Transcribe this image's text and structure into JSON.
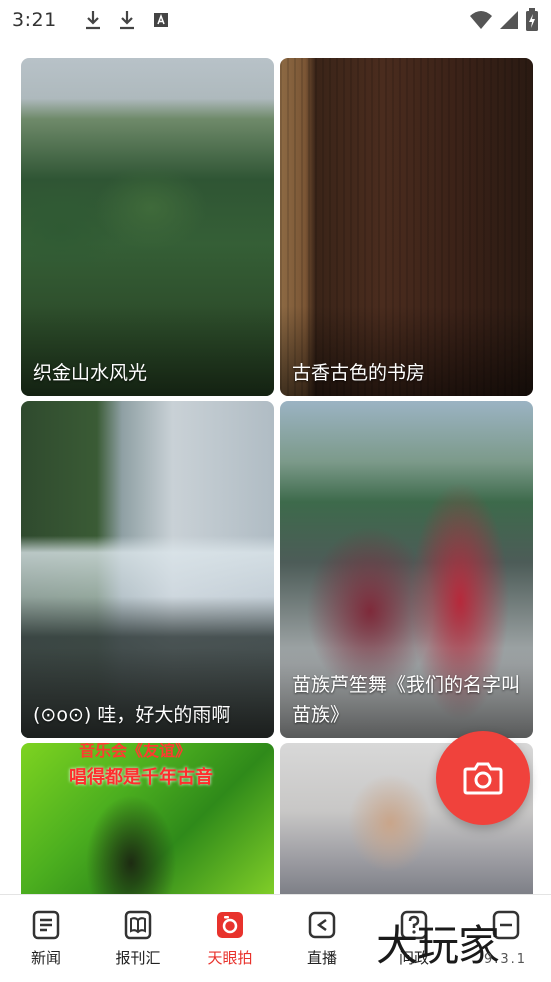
{
  "status_bar": {
    "time": "3:21",
    "left_icons": [
      "download-icon",
      "download-icon",
      "font-icon"
    ],
    "right_icons": [
      "wifi-icon",
      "signal-icon",
      "battery-icon"
    ]
  },
  "feed": {
    "cards": [
      {
        "caption": "织金山水风光",
        "thumb": "mountain-landscape-thumbnail"
      },
      {
        "caption": "古香古色的书房",
        "thumb": "wooden-study-thumbnail"
      },
      {
        "caption": "(⊙o⊙) 哇，好大的雨啊",
        "thumb": "heavy-rain-thumbnail"
      },
      {
        "caption": "苗族芦笙舞《我们的名字叫苗族》",
        "thumb": "miao-dance-thumbnail"
      },
      {
        "caption": "",
        "thumb": "music-concert-thumbnail",
        "overlay_line1": "音乐会《友谊》",
        "overlay_line2": "唱得都是千年古音"
      },
      {
        "caption": "",
        "thumb": "elderly-woman-thumbnail"
      }
    ]
  },
  "fab": {
    "icon": "camera-icon",
    "color": "#f0423c"
  },
  "bottom_nav": {
    "items": [
      {
        "label": "新闻",
        "icon": "news-icon"
      },
      {
        "label": "报刊汇",
        "icon": "book-icon"
      },
      {
        "label": "天眼拍",
        "icon": "camera-eye-icon",
        "active": true
      },
      {
        "label": "直播",
        "icon": "live-icon"
      },
      {
        "label": "问政",
        "icon": "question-icon"
      },
      {
        "label": "",
        "icon": "more-icon"
      }
    ],
    "active_color": "#e8322c"
  },
  "watermark": {
    "text": "大玩家",
    "small_text": "9.3.1"
  }
}
